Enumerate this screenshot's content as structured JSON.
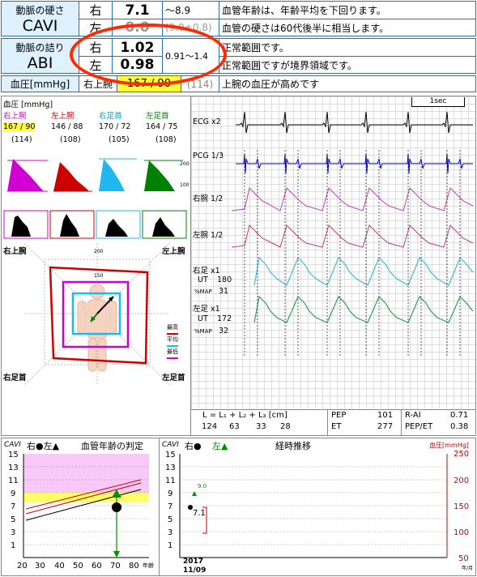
{
  "top": {
    "cavi_label_1": "動脈の硬さ",
    "cavi_label_2": "CAVI",
    "cavi_right_side": "右",
    "cavi_right_value": "7.1",
    "cavi_ref": "～8.9",
    "cavi_msg_1": "血管年齢は、年齢平均を下回ります。",
    "cavi_left_side": "左",
    "cavi_left_value": "0.0",
    "cavi_left_ref": "(9.0±0.8)",
    "cavi_msg_2": "血管の硬さは60代後半に相当します。",
    "abi_label_1": "動脈の詰り",
    "abi_label_2": "ABI",
    "abi_right_side": "右",
    "abi_right_value": "1.02",
    "abi_ref": "0.91～1.4",
    "abi_msg_1": "正常範囲です。",
    "abi_left_side": "左",
    "abi_left_value": "0.98",
    "abi_msg_2": "正常範囲ですが境界領域です。",
    "bp_label": "血圧[mmHg]",
    "bp_side": "右上腕",
    "bp_value": "167 / 90",
    "bp_extra": "(114)",
    "bp_msg": "上腕の血圧が高めです"
  },
  "bp_table": {
    "title": "血圧 [mmHg]",
    "cols": [
      {
        "name": "右上腕",
        "value": "167 / 90",
        "mean": "(114)",
        "color": "#d000d0"
      },
      {
        "name": "左上腕",
        "value": "146 / 88",
        "mean": "(108)",
        "color": "#d00000"
      },
      {
        "name": "右足首",
        "value": "170 / 72",
        "mean": "(105)",
        "color": "#00a0e0"
      },
      {
        "name": "左足首",
        "value": "164 / 75",
        "mean": "(108)",
        "color": "#008000"
      }
    ]
  },
  "radar": {
    "top_left": "右上腕",
    "top_right": "左上腕",
    "bottom_left": "右足首",
    "bottom_right": "左足首",
    "scale_top": "200",
    "scale_mid": "150",
    "scale_inner": "50",
    "legend": [
      "最高",
      "平均",
      "最低"
    ]
  },
  "waves": {
    "scale": "1sec",
    "ecg": "ECG x2",
    "pcg": "PCG 1/3",
    "r_arm": "右腕 1/2",
    "l_arm": "左腕 1/2",
    "r_leg": "右足 x1",
    "r_ut": "UT",
    "r_ut_val": "180",
    "r_map": "%MAP",
    "r_map_val": "31",
    "l_leg": "左足 x1",
    "l_ut": "UT",
    "l_ut_val": "172",
    "l_map": "%MAP",
    "l_map_val": "32"
  },
  "stats": {
    "formula": "L  =  L₁ +  L₂ +  L₃ [cm]",
    "l_vals": [
      "124",
      "63",
      "33",
      "28"
    ],
    "pep_label": "PEP",
    "pep_val": "101",
    "et_label": "ET",
    "et_val": "277",
    "rai_label": "R-AI",
    "rai_val": "0.71",
    "pepet_label": "PEP/ET",
    "pepet_val": "0.38"
  },
  "cavi_chart": {
    "cavi_label": "CAVI",
    "legend": "右●左▲",
    "title": "血管年齢の判定",
    "y_ticks": [
      "15",
      "13",
      "11",
      "9",
      "7",
      "5",
      "3",
      "1"
    ],
    "x_ticks": [
      "20",
      "30",
      "40",
      "50",
      "60",
      "70",
      "80"
    ],
    "x_unit": "年齢"
  },
  "trend_chart": {
    "cavi_label": "CAVI",
    "legend_right": "右●",
    "legend_left": "左▲",
    "title": "経時推移",
    "bp_axis": "血圧[mmHg]",
    "y_ticks": [
      "15",
      "13",
      "11",
      "9",
      "7",
      "5",
      "3",
      "1"
    ],
    "r_ticks": [
      "250",
      "200",
      "150",
      "100",
      "50"
    ],
    "point_label_1": "9.0",
    "point_label_2": "7.1",
    "date_1": "2017",
    "date_2": "11/09",
    "x_unit_label": "年/月"
  }
}
